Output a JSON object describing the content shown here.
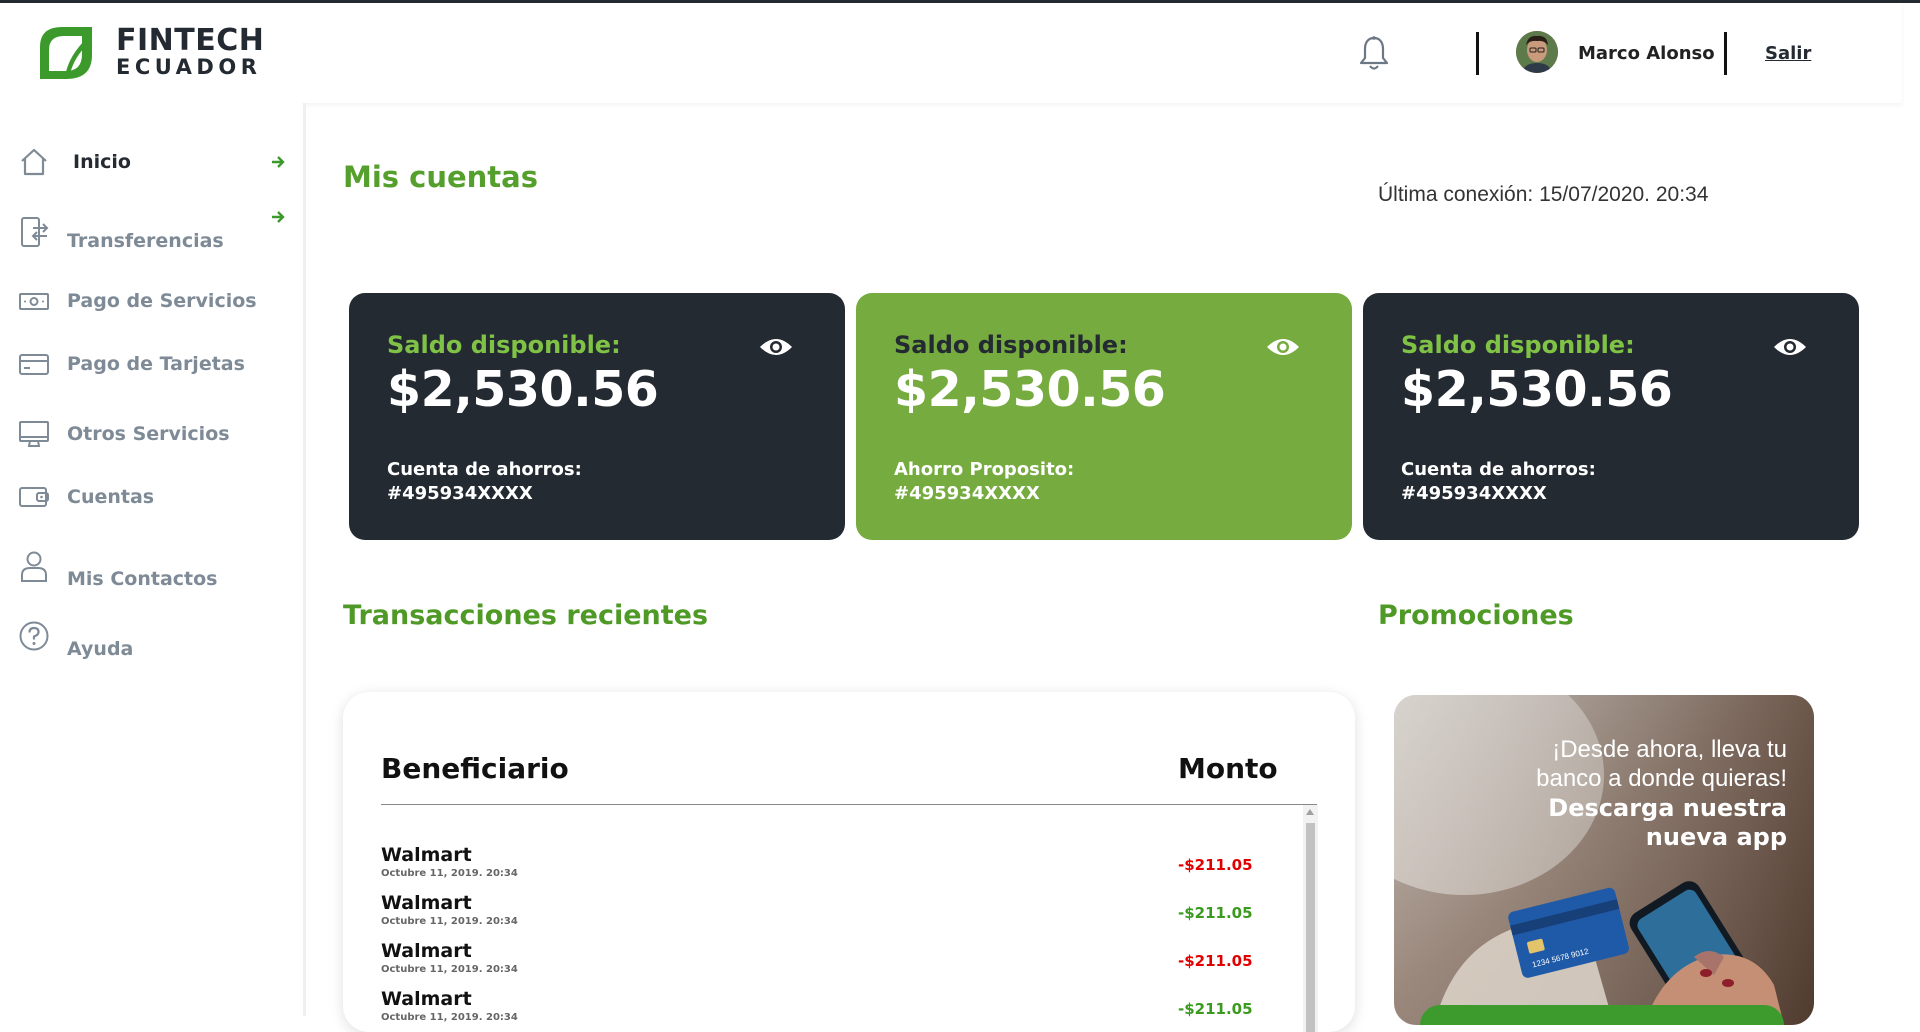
{
  "brand": {
    "line1": "FINTECH",
    "line2": "ECUADOR",
    "green": "#55a02d",
    "dark": "#242a31"
  },
  "header": {
    "user_name": "Marco Alonso",
    "logout_label": "Salir",
    "bell_icon": "bell-icon"
  },
  "sidebar": {
    "items": [
      {
        "label": "Inicio",
        "icon": "home-icon",
        "active": true,
        "arrow": true
      },
      {
        "label": "Transferencias",
        "icon": "transfer-icon",
        "active": false,
        "arrow": true
      },
      {
        "label": "Pago de Servicios",
        "icon": "bill-icon",
        "active": false,
        "arrow": false
      },
      {
        "label": "Pago de Tarjetas",
        "icon": "card-icon",
        "active": false,
        "arrow": false
      },
      {
        "label": "Otros Servicios",
        "icon": "monitor-icon",
        "active": false,
        "arrow": false
      },
      {
        "label": "Cuentas",
        "icon": "wallet-icon",
        "active": false,
        "arrow": false
      },
      {
        "label": "Mis Contactos",
        "icon": "user-icon",
        "active": false,
        "arrow": false
      },
      {
        "label": "Ayuda",
        "icon": "help-icon",
        "active": false,
        "arrow": false
      }
    ]
  },
  "main": {
    "title": "Mis cuentas",
    "last_connection": "Última conexión: 15/07/2020. 20:34",
    "cards": [
      {
        "label": "Saldo disponible:",
        "amount": "$2,530.56",
        "type": "Cuenta de ahorros:",
        "number": "#495934XXXX",
        "theme": "dark"
      },
      {
        "label": "Saldo disponible:",
        "amount": "$2,530.56",
        "type": "Ahorro Proposito:",
        "number": "#495934XXXX",
        "theme": "green"
      },
      {
        "label": "Saldo disponible:",
        "amount": "$2,530.56",
        "type": "Cuenta de ahorros:",
        "number": "#495934XXXX",
        "theme": "dark"
      }
    ],
    "transactions_title": "Transacciones recientes",
    "promotions_title": "Promociones"
  },
  "transactions": {
    "header_beneficiary": "Beneficiario",
    "header_amount": "Monto",
    "rows": [
      {
        "name": "Walmart",
        "date": "Octubre 11, 2019. 20:34",
        "amount": "-$211.05",
        "color": "#e00000"
      },
      {
        "name": "Walmart",
        "date": "Octubre 11, 2019. 20:34",
        "amount": "-$211.05",
        "color": "#3a9a1e"
      },
      {
        "name": "Walmart",
        "date": "Octubre 11, 2019. 20:34",
        "amount": "-$211.05",
        "color": "#e00000"
      },
      {
        "name": "Walmart",
        "date": "Octubre 11, 2019. 20:34",
        "amount": "-$211.05",
        "color": "#3a9a1e"
      }
    ]
  },
  "promo": {
    "line1": "¡Desde ahora, lleva tu",
    "line2": "banco a donde quieras!",
    "line3": "Descarga nuestra",
    "line4": "nueva app"
  }
}
